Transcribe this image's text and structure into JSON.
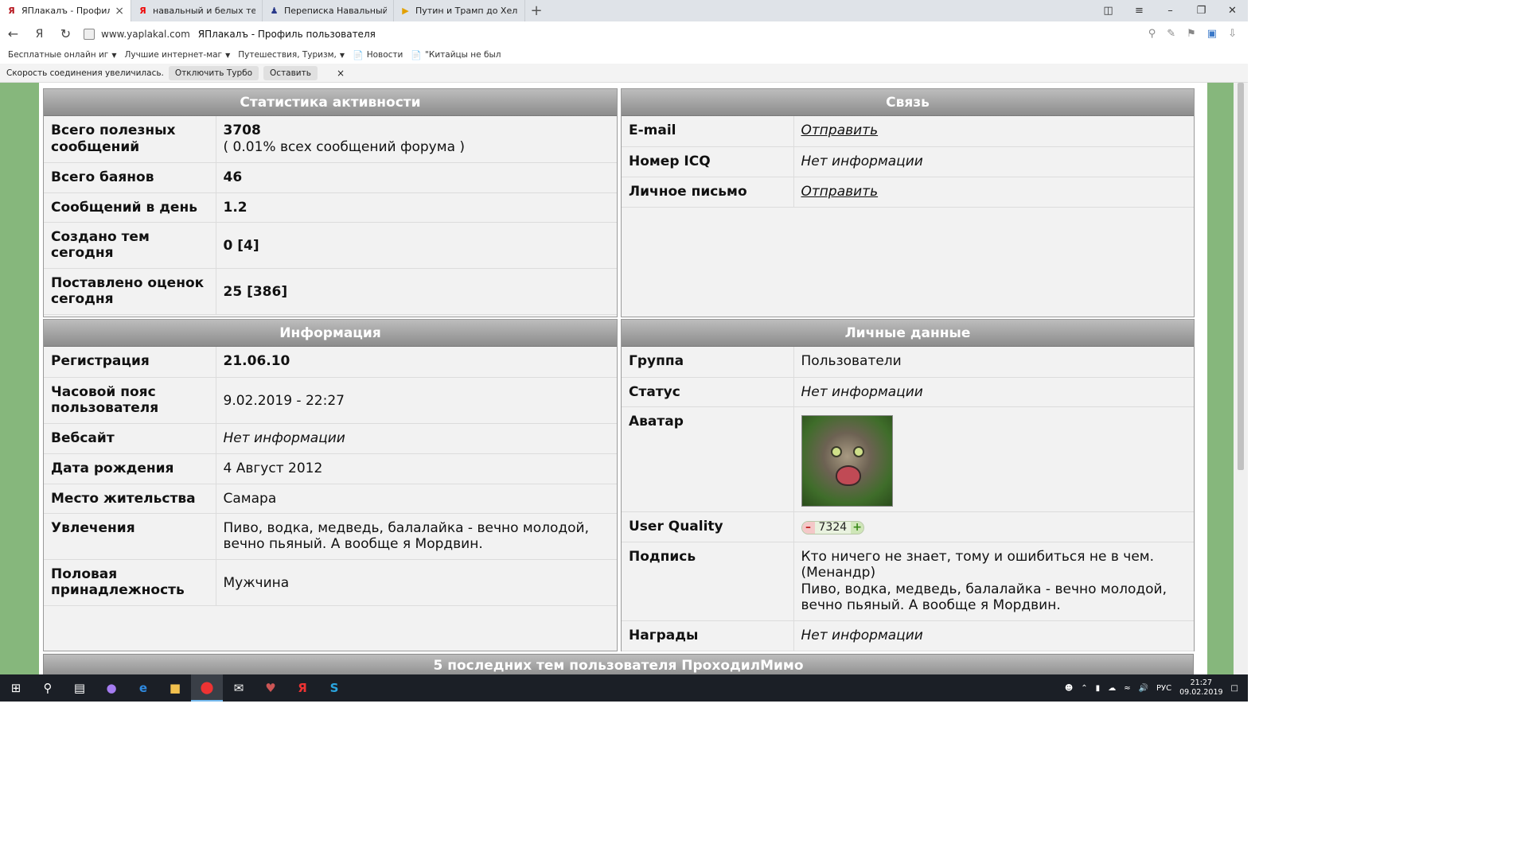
{
  "tabs": [
    {
      "label": "ЯПлакалъ - Профиль по",
      "icon": "yaplakal-favicon",
      "active": true
    },
    {
      "label": "навальный и белых телеф",
      "icon": "yandex-favicon"
    },
    {
      "label": "Переписка Навальный- Бе",
      "icon": "user-favicon"
    },
    {
      "label": "Путин и Трамп до Хельсин",
      "icon": "play-favicon"
    }
  ],
  "address": {
    "url": "www.yaplakal.com",
    "title": "ЯПлакалъ - Профиль пользователя"
  },
  "bookmarks": [
    {
      "label": "Бесплатные онлайн иг",
      "has_arrow": true
    },
    {
      "label": "Лучшие интернет-маг",
      "has_arrow": true
    },
    {
      "label": "Путешествия, Туризм,",
      "has_arrow": true
    },
    {
      "label": "Новости",
      "has_doc": true
    },
    {
      "label": "\"Китайцы не был",
      "has_doc": true
    }
  ],
  "turbo": {
    "message": "Скорость соединения увеличилась.",
    "disable_label": "Отключить Турбо",
    "keep_label": "Оставить",
    "close": "×"
  },
  "stats": {
    "title": "Статистика активности",
    "rows": [
      {
        "label": "Всего полезных сообщений",
        "value": "3708",
        "sub": "( 0.01% всех сообщений форума )"
      },
      {
        "label": "Всего баянов",
        "value": "46"
      },
      {
        "label": "Сообщений в день",
        "value": "1.2"
      },
      {
        "label": "Создано тем сегодня",
        "value": "0 [4]"
      },
      {
        "label": "Поставлено оценок сегодня",
        "value": "25 [386]"
      }
    ]
  },
  "contact": {
    "title": "Связь",
    "rows": [
      {
        "label": "E-mail",
        "value": "Отправить"
      },
      {
        "label": "Номер ICQ",
        "value": "Нет информации"
      },
      {
        "label": "Личное письмо",
        "value": "Отправить"
      }
    ]
  },
  "info": {
    "title": "Информация",
    "rows": [
      {
        "label": "Регистрация",
        "value": "21.06.10"
      },
      {
        "label": "Часовой пояс пользователя",
        "value": "9.02.2019 - 22:27"
      },
      {
        "label": "Вебсайт",
        "value": "Нет информации"
      },
      {
        "label": "Дата рождения",
        "value": "4 Август 2012"
      },
      {
        "label": "Место жительства",
        "value": "Самара"
      },
      {
        "label": "Увлечения",
        "value": "Пиво, водка, медведь, балалайка - вечно молодой, вечно пьяный. А вообще я Мордвин."
      },
      {
        "label": "Половая принадлежность",
        "value": "Мужчина"
      }
    ]
  },
  "personal": {
    "title": "Личные данные",
    "group_label": "Группа",
    "group_value": "Пользователи",
    "status_label": "Статус",
    "status_value": "Нет информации",
    "avatar_label": "Аватар",
    "uq_label": "User Quality",
    "uq_value": "7324",
    "uq_minus": "–",
    "uq_plus": "+",
    "signature_label": "Подпись",
    "signature_line1": "Кто ничего не знает, тому и ошибиться не в чем. (Менандр)",
    "signature_line2": "Пиво, водка, медведь, балалайка - вечно молодой, вечно пьяный. А вообще я Мордвин.",
    "awards_label": "Награды",
    "awards_value": "Нет информации"
  },
  "bottom_title": "5 последних тем пользователя ПроходилМимо",
  "taskbar": {
    "lang": "РУС",
    "time": "21:27",
    "date": "09.02.2019"
  },
  "colors": {
    "page_bg": "#86b77c",
    "header_gradient_top": "#bdbdbd",
    "header_gradient_bottom": "#8c8c8c"
  }
}
